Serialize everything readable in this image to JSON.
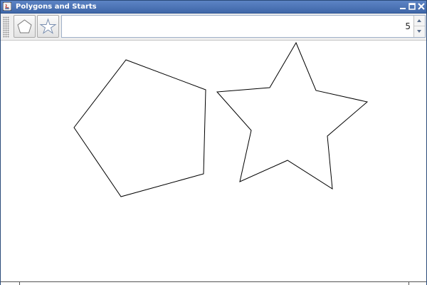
{
  "window": {
    "title": "Polygons and Starts"
  },
  "toolbar": {
    "polygon_tool": "polygon-icon",
    "star_tool": "star-icon"
  },
  "spinner": {
    "value": "5"
  },
  "colors": {
    "titlebar": "#4a70b0",
    "shape_stroke": "#000000"
  }
}
